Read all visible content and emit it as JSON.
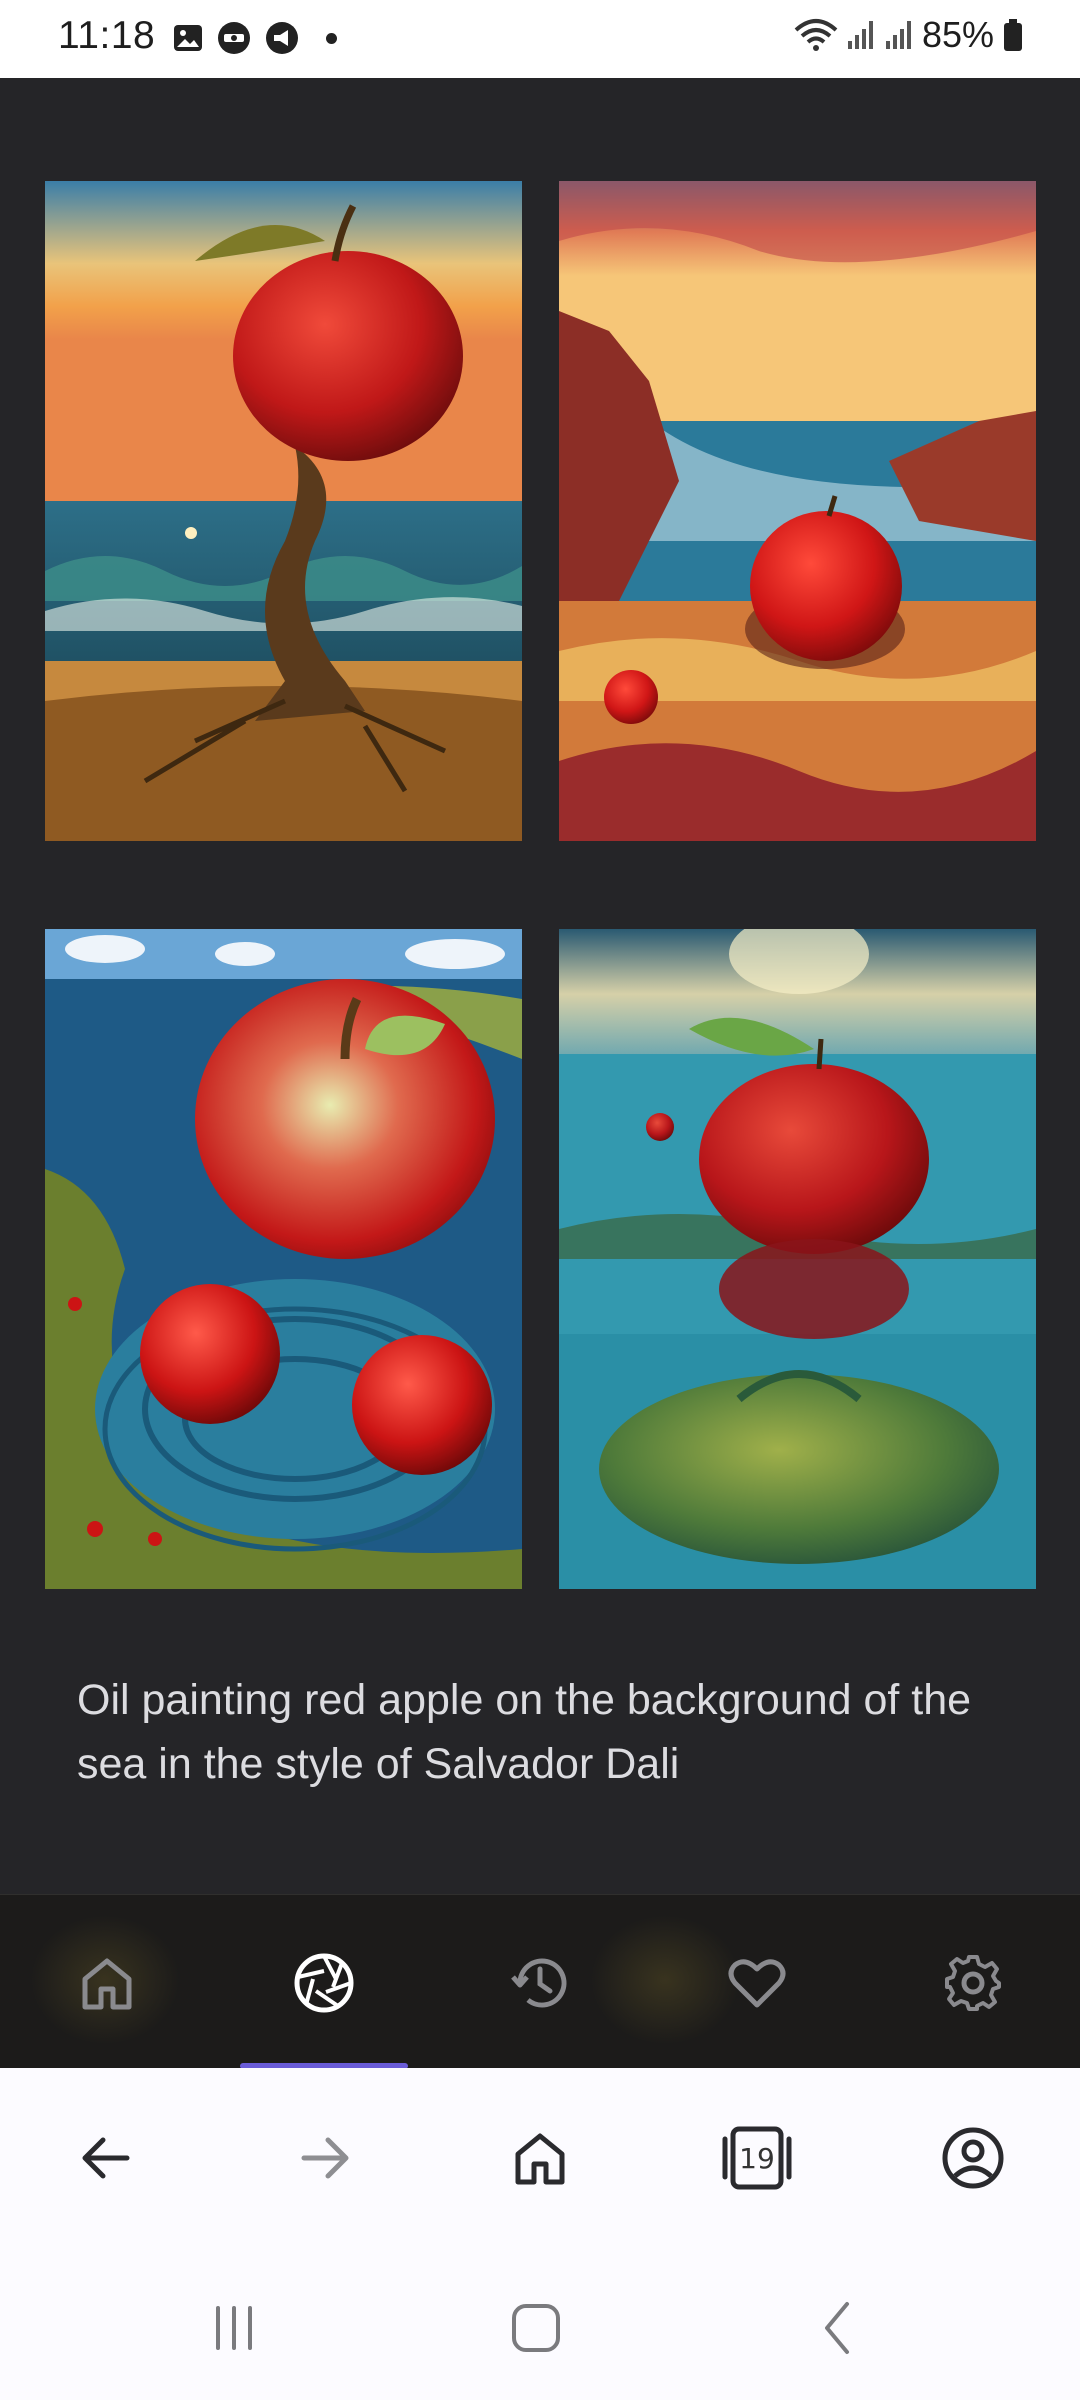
{
  "status_bar": {
    "time": "11:18",
    "battery": "85%"
  },
  "gallery": {
    "images": [
      {
        "alt_icon": "apple-on-twisted-trunk-image"
      },
      {
        "alt_icon": "apple-on-rocky-shore-image"
      },
      {
        "alt_icon": "apples-in-swirling-water-image"
      },
      {
        "alt_icon": "apple-floating-over-sea-image"
      }
    ],
    "prompt": "Oil painting red apple on the background of the sea in the style of Salvador Dali"
  },
  "app_nav": {
    "items": [
      {
        "icon": "home-icon"
      },
      {
        "icon": "camera-aperture-icon",
        "active": true
      },
      {
        "icon": "history-icon"
      },
      {
        "icon": "heart-icon"
      },
      {
        "icon": "gear-icon"
      }
    ],
    "accent": "#6a5cd8"
  },
  "browser_bar": {
    "tab_count": "19"
  }
}
